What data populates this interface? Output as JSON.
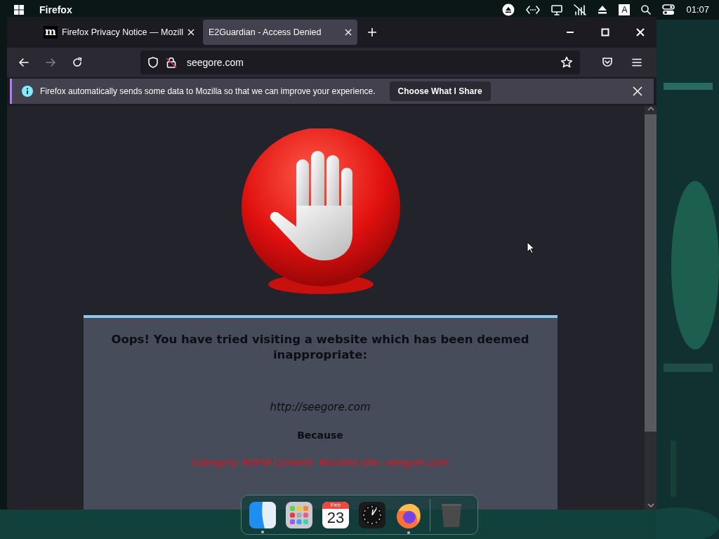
{
  "menubar": {
    "app_name": "Firefox",
    "input_indicator": "A",
    "clock": "01:07"
  },
  "tabs": [
    {
      "title": "Firefox Privacy Notice — Mozill",
      "favicon_letter": "m",
      "selected": false
    },
    {
      "title": "E2Guardian - Access Denied",
      "selected": true
    }
  ],
  "toolbar": {
    "back_disabled": false,
    "forward_disabled": true,
    "address": "seegore.com"
  },
  "notification": {
    "message": "Firefox automatically sends some data to Mozilla so that we can improve your experience.",
    "button": "Choose What I Share"
  },
  "page": {
    "heading": "Oops! You have tried visiting a website which has been deemed inappropriate:",
    "url": "http://seegore.com",
    "because": "Because",
    "reason": "Category: NSFW Content  Blocked site: seegore.com"
  },
  "dock": [
    {
      "kind": "finder",
      "running": true
    },
    {
      "kind": "launchpad",
      "running": false
    },
    {
      "kind": "calendar",
      "month": "Feb",
      "day": "23",
      "running": false
    },
    {
      "kind": "clock",
      "running": false
    },
    {
      "kind": "firefox",
      "running": true
    },
    {
      "kind": "separator"
    },
    {
      "kind": "trash",
      "running": false
    }
  ]
}
